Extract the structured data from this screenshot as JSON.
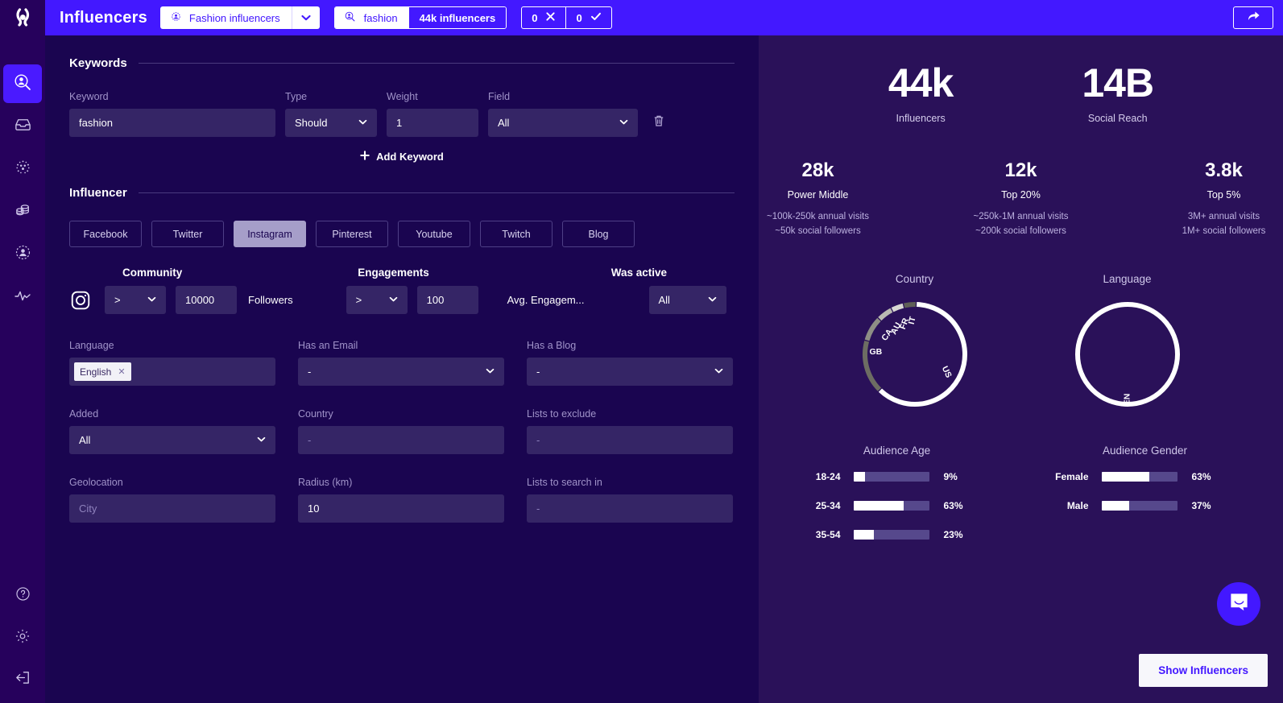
{
  "header": {
    "title": "Influencers",
    "saved_search": "Fashion influencers",
    "saved_search_icon": "target-influencer-icon",
    "caret_icon": "chevron-down-icon",
    "search_icon": "search-user-icon",
    "search_value": "fashion",
    "result_badge": "44k influencers",
    "reject_count": "0",
    "reject_icon": "close-icon",
    "accept_count": "0",
    "accept_icon": "check-icon",
    "share_icon": "share-arrow-icon"
  },
  "rail": {
    "logo_icon": "brand-logo-icon",
    "items": [
      {
        "icon": "search-influencer-icon",
        "active": true
      },
      {
        "icon": "inbox-icon",
        "active": false
      },
      {
        "icon": "dots-cluster-icon",
        "active": false
      },
      {
        "icon": "coins-icon",
        "active": false
      },
      {
        "icon": "audience-circle-icon",
        "active": false
      },
      {
        "icon": "activity-pulse-icon",
        "active": false
      }
    ],
    "bottom": [
      {
        "icon": "help-circle-icon"
      },
      {
        "icon": "gear-icon"
      },
      {
        "icon": "logout-icon"
      }
    ]
  },
  "keywords": {
    "section_title": "Keywords",
    "labels": {
      "keyword": "Keyword",
      "type": "Type",
      "weight": "Weight",
      "field": "Field"
    },
    "rows": [
      {
        "keyword": "fashion",
        "type": "Should",
        "weight": "1",
        "field": "All",
        "delete_icon": "trash-icon"
      }
    ],
    "add_label": "Add Keyword",
    "add_icon": "plus-icon"
  },
  "influencer": {
    "section_title": "Influencer",
    "networks": [
      {
        "label": "Facebook",
        "active": false
      },
      {
        "label": "Twitter",
        "active": false
      },
      {
        "label": "Instagram",
        "active": true
      },
      {
        "label": "Pinterest",
        "active": false
      },
      {
        "label": "Youtube",
        "active": false
      },
      {
        "label": "Twitch",
        "active": false
      },
      {
        "label": "Blog",
        "active": false
      }
    ],
    "group_labels": {
      "community": "Community",
      "engagements": "Engagements",
      "was_active": "Was active"
    },
    "network_icon": "instagram-icon",
    "community_operator": ">",
    "community_value": "10000",
    "community_unit": "Followers",
    "engagement_operator": ">",
    "engagement_value": "100",
    "engagement_unit": "Avg. Engagem...",
    "was_active_value": "All"
  },
  "filters": [
    {
      "label": "Language",
      "kind": "chips",
      "chips": [
        {
          "text": "English",
          "remove_icon": "close-icon"
        }
      ]
    },
    {
      "label": "Has an Email",
      "kind": "select",
      "value": "-"
    },
    {
      "label": "Has a Blog",
      "kind": "select",
      "value": "-"
    },
    {
      "label": "Added",
      "kind": "select",
      "value": "All"
    },
    {
      "label": "Country",
      "kind": "input",
      "value": "-"
    },
    {
      "label": "Lists to exclude",
      "kind": "input",
      "value": "-"
    },
    {
      "label": "Geolocation",
      "kind": "input",
      "value": "City",
      "dim": true
    },
    {
      "label": "Radius (km)",
      "kind": "input",
      "value": "10"
    },
    {
      "label": "Lists to search in",
      "kind": "input",
      "value": "-"
    }
  ],
  "stats": {
    "big": [
      {
        "value": "44k",
        "label": "Influencers"
      },
      {
        "value": "14B",
        "label": "Social Reach"
      }
    ],
    "tiers": [
      {
        "value": "28k",
        "label": "Power Middle",
        "line1": "~100k-250k annual visits",
        "line2": "~50k social followers"
      },
      {
        "value": "12k",
        "label": "Top 20%",
        "line1": "~250k-1M annual visits",
        "line2": "~200k social followers"
      },
      {
        "value": "3.8k",
        "label": "Top 5%",
        "line1": "3M+ annual visits",
        "line2": "1M+ social followers"
      }
    ]
  },
  "chart_data": [
    {
      "type": "pie",
      "title": "Country",
      "labels": [
        "US",
        "GB",
        "CA",
        "AU",
        "FR",
        "IT"
      ],
      "values": [
        62,
        17,
        8,
        5,
        4,
        4
      ],
      "colors": [
        "#ffffff",
        "#6d6d63",
        "#8e8e85",
        "#b9b9b2",
        "#d8d8d3",
        "#5f5f57"
      ],
      "legend": "on-arc"
    },
    {
      "type": "pie",
      "title": "Language",
      "labels": [
        "EN"
      ],
      "values": [
        100
      ],
      "colors": [
        "#ffffff"
      ],
      "legend": "on-arc"
    },
    {
      "type": "bar",
      "title": "Audience Age",
      "orientation": "horizontal",
      "categories": [
        "18-24",
        "25-34",
        "35-54"
      ],
      "values": [
        9,
        63,
        23
      ],
      "value_labels": [
        "9%",
        "63%",
        "23%"
      ],
      "xlim": [
        0,
        100
      ],
      "bar_color": "#ffffff",
      "track_color": "#56488c"
    },
    {
      "type": "bar",
      "title": "Audience Gender",
      "orientation": "horizontal",
      "categories": [
        "Female",
        "Male"
      ],
      "values": [
        63,
        37
      ],
      "value_labels": [
        "63%",
        "37%"
      ],
      "xlim": [
        0,
        100
      ],
      "bar_color": "#ffffff",
      "track_color": "#56488c"
    }
  ],
  "footer": {
    "intercom_icon": "chat-bubble-icon",
    "show_button": "Show Influencers"
  }
}
